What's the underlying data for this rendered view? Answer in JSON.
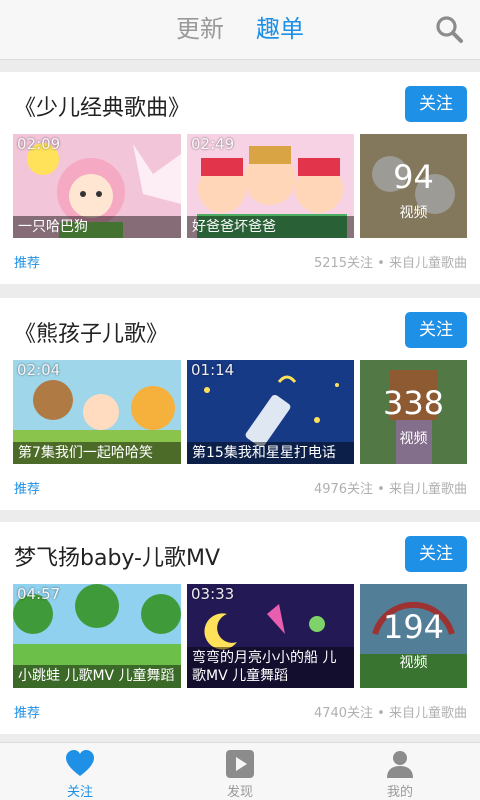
{
  "header": {
    "tab_update": "更新",
    "tab_fun": "趣单",
    "search_icon": "search-icon"
  },
  "cards": [
    {
      "title": "《少儿经典歌曲》",
      "follow_label": "关注",
      "videos": [
        {
          "duration": "02:09",
          "caption": "一只哈巴狗"
        },
        {
          "duration": "02:49",
          "caption": "好爸爸坏爸爸"
        }
      ],
      "count": {
        "value": "94",
        "label": "视频"
      },
      "tag": "推荐",
      "meta": "5215关注 • 来自儿童歌曲"
    },
    {
      "title": "《熊孩子儿歌》",
      "follow_label": "关注",
      "videos": [
        {
          "duration": "02:04",
          "caption": "第7集我们一起哈哈笑"
        },
        {
          "duration": "01:14",
          "caption": "第15集我和星星打电话"
        }
      ],
      "count": {
        "value": "338",
        "label": "视频"
      },
      "tag": "推荐",
      "meta": "4976关注 • 来自儿童歌曲"
    },
    {
      "title": "梦飞扬baby-儿歌MV",
      "follow_label": "关注",
      "videos": [
        {
          "duration": "04:57",
          "caption": "小跳蛙 儿歌MV 儿童舞蹈"
        },
        {
          "duration": "03:33",
          "caption": "弯弯的月亮小小的船 儿歌MV 儿童舞蹈"
        }
      ],
      "count": {
        "value": "194",
        "label": "视频"
      },
      "tag": "推荐",
      "meta": "4740关注 • 来自儿童歌曲"
    }
  ],
  "bottom_nav": [
    {
      "label": "关注",
      "icon": "heart-icon",
      "active": true
    },
    {
      "label": "发现",
      "icon": "play-icon",
      "active": false
    },
    {
      "label": "我的",
      "icon": "user-icon",
      "active": false
    }
  ],
  "colors": {
    "accent": "#1e90e6",
    "muted": "#9a9a9a",
    "meta": "#b0b0b0"
  }
}
